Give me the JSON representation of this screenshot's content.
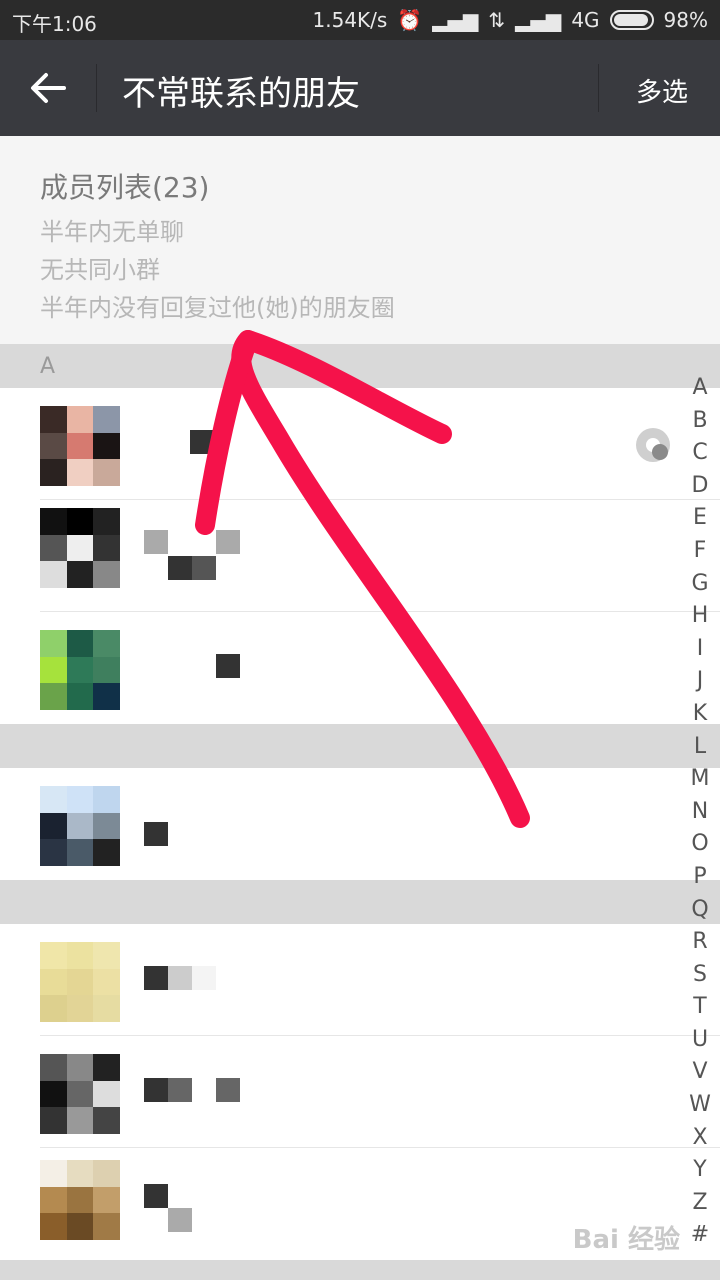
{
  "status_bar": {
    "time": "下午1:06",
    "net_speed": "1.54K/s",
    "network": "4G",
    "battery": "98%"
  },
  "title_bar": {
    "back_icon": "arrow-left-icon",
    "title": "不常联系的朋友",
    "multi_select": "多选"
  },
  "info": {
    "count": "成员列表(23)",
    "criteria": [
      "半年内无单聊",
      "无共同小群",
      "半年内没有回复过他(她)的朋友圈"
    ]
  },
  "section_header": "A",
  "index_letters": [
    "A",
    "B",
    "C",
    "D",
    "E",
    "F",
    "G",
    "H",
    "I",
    "J",
    "K",
    "L",
    "M",
    "N",
    "O",
    "P",
    "Q",
    "R",
    "S",
    "T",
    "U",
    "V",
    "W",
    "X",
    "Y",
    "Z",
    "#"
  ],
  "colors": {
    "title_bar": "#393a3f",
    "status_bar": "#2b2b2b",
    "annotation": "#f5124a"
  },
  "watermark": "Bai 经验"
}
